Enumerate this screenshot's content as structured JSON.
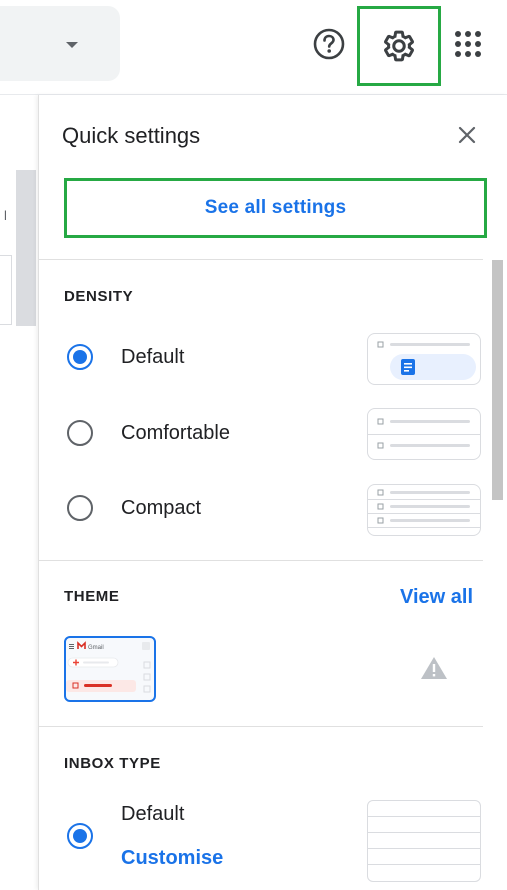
{
  "topbar": {
    "search_dropdown_icon": "chevron-down-icon",
    "help_icon": "help-circle-icon",
    "settings_icon": "gear-icon",
    "apps_icon": "apps-grid-icon"
  },
  "left_fragment": {
    "text": "l"
  },
  "quick_settings": {
    "title": "Quick settings",
    "close_icon": "close-icon",
    "see_all_label": "See all settings",
    "density": {
      "heading": "DENSITY",
      "options": [
        {
          "label": "Default",
          "selected": true
        },
        {
          "label": "Comfortable",
          "selected": false
        },
        {
          "label": "Compact",
          "selected": false
        }
      ]
    },
    "theme": {
      "heading": "THEME",
      "view_all_label": "View all",
      "thumbnail_brand": "Gmail"
    },
    "inbox_type": {
      "heading": "INBOX TYPE",
      "option_label": "Default",
      "customise_label": "Customise",
      "selected": true
    }
  },
  "colors": {
    "accent_blue": "#1a73e8",
    "highlight_green": "#26a944",
    "text_primary": "#202124",
    "icon_grey": "#5f6368"
  }
}
